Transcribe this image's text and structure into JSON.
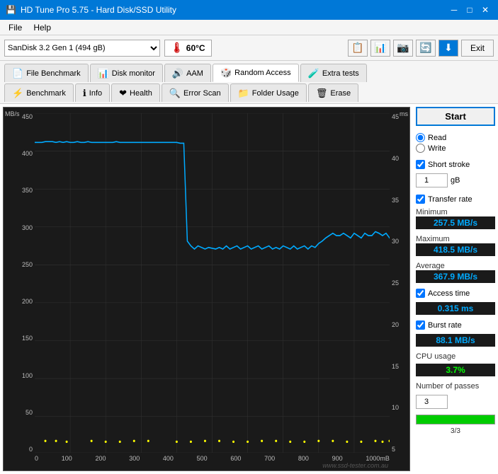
{
  "titleBar": {
    "title": "HD Tune Pro 5.75 - Hard Disk/SSD Utility",
    "icon": "💾"
  },
  "menuBar": {
    "items": [
      "File",
      "Help"
    ]
  },
  "toolbar": {
    "diskSelect": {
      "value": "SanDisk 3.2 Gen 1 (494 gB)",
      "options": [
        "SanDisk 3.2 Gen 1 (494 gB)"
      ]
    },
    "temperature": "60°C",
    "exitLabel": "Exit"
  },
  "tabs": {
    "row1": [
      {
        "id": "file-benchmark",
        "label": "File Benchmark",
        "icon": "📄"
      },
      {
        "id": "disk-monitor",
        "label": "Disk monitor",
        "icon": "📊"
      },
      {
        "id": "aam",
        "label": "AAM",
        "icon": "🔊"
      },
      {
        "id": "random-access",
        "label": "Random Access",
        "icon": "🎲",
        "active": true
      },
      {
        "id": "extra-tests",
        "label": "Extra tests",
        "icon": "🧪"
      }
    ],
    "row2": [
      {
        "id": "benchmark",
        "label": "Benchmark",
        "icon": "⚡"
      },
      {
        "id": "info",
        "label": "Info",
        "icon": "ℹ"
      },
      {
        "id": "health",
        "label": "Health",
        "icon": "❤"
      },
      {
        "id": "error-scan",
        "label": "Error Scan",
        "icon": "🔍"
      },
      {
        "id": "folder-usage",
        "label": "Folder Usage",
        "icon": "📁"
      },
      {
        "id": "erase",
        "label": "Erase",
        "icon": "🗑"
      }
    ]
  },
  "chart": {
    "yAxisLabel": "MB/s",
    "y2AxisLabel": "ms",
    "yLabels": [
      "450",
      "400",
      "350",
      "300",
      "250",
      "200",
      "150",
      "100",
      "50",
      "0"
    ],
    "y2Labels": [
      "45",
      "40",
      "35",
      "30",
      "25",
      "20",
      "15",
      "10",
      "5"
    ],
    "xLabels": [
      "0",
      "100",
      "200",
      "300",
      "400",
      "500",
      "600",
      "700",
      "800",
      "900",
      "1000mB"
    ],
    "watermark": "www.ssd-tester.com.au"
  },
  "rightPanel": {
    "startLabel": "Start",
    "readLabel": "Read",
    "writeLabel": "Write",
    "shortStrokeLabel": "Short stroke",
    "shortStrokeValue": "1",
    "shortStrokeUnit": "gB",
    "transferRateLabel": "Transfer rate",
    "minimumLabel": "Minimum",
    "minimumValue": "257.5 MB/s",
    "maximumLabel": "Maximum",
    "maximumValue": "418.5 MB/s",
    "averageLabel": "Average",
    "averageValue": "367.9 MB/s",
    "accessTimeLabel": "Access time",
    "accessTimeValue": "0.315 ms",
    "burstRateLabel": "Burst rate",
    "burstRateValue": "88.1 MB/s",
    "cpuUsageLabel": "CPU usage",
    "cpuUsageValue": "3.7%",
    "numberOfPassesLabel": "Number of passes",
    "numberOfPassesValue": "3",
    "progressLabel": "3/3",
    "progressPercent": 100
  }
}
